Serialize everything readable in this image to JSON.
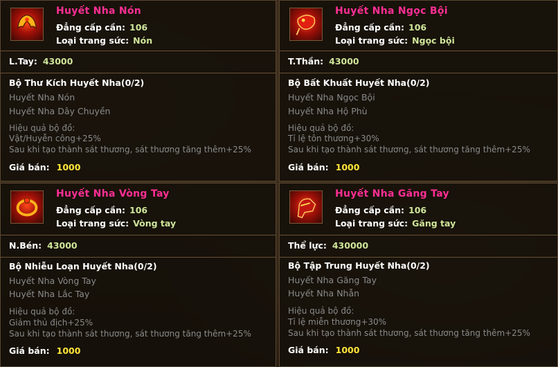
{
  "items": [
    {
      "name": "Huyết Nha Nón",
      "level_label": "Đẳng cấp cần:",
      "level": "106",
      "type_label": "Loại trang sức:",
      "type": "Nón",
      "stat_label": "L.Tay:",
      "stat_value": "43000",
      "set_title": "Bộ Thư Kích Huyết Nha(0/2)",
      "set_pieces": [
        "Huyết Nha Nón",
        "Huyết Nha Dây Chuyền"
      ],
      "effect_label": "Hiệu quả bộ đồ:",
      "effects": [
        "Vật/Huyễn công+25%",
        "Sau khi tạo thành sát thương, sát thương tăng thêm+25%"
      ],
      "price_label": "Giá bán:",
      "price": "1000",
      "icon": "helmet-icon"
    },
    {
      "name": "Huyết Nha Ngọc Bội",
      "level_label": "Đẳng cấp cần:",
      "level": "106",
      "type_label": "Loại trang sức:",
      "type": "Ngọc bội",
      "stat_label": "T.Thần:",
      "stat_value": "43000",
      "set_title": "Bộ Bất Khuất Huyết Nha(0/2)",
      "set_pieces": [
        "Huyết Nha Ngọc Bội",
        "Huyết Nha Hộ Phù"
      ],
      "effect_label": "Hiệu quả bộ đồ:",
      "effects": [
        "Tỉ lệ tôn thương+30%",
        "Sau khi tạo thành sát thương, sát thương tăng thêm+25%"
      ],
      "price_label": "Giá bán:",
      "price": "1000",
      "icon": "pendant-icon"
    },
    {
      "name": "Huyết Nha Vòng Tay",
      "level_label": "Đẳng cấp cần:",
      "level": "106",
      "type_label": "Loại trang sức:",
      "type": "Vòng tay",
      "stat_label": "N.Bén:",
      "stat_value": "43000",
      "set_title": "Bộ Nhiễu Loạn Huyết Nha(0/2)",
      "set_pieces": [
        "Huyết Nha Vòng Tay",
        "Huyết Nha Lắc Tay"
      ],
      "effect_label": "Hiệu quả bộ đồ:",
      "effects": [
        "Giảm thủ địch+25%",
        "Sau khi tạo thành sát thương, sát thương tăng thêm+25%"
      ],
      "price_label": "Giá bán:",
      "price": "1000",
      "icon": "bracelet-icon"
    },
    {
      "name": "Huyết Nha Găng Tay",
      "level_label": "Đẳng cấp cần:",
      "level": "106",
      "type_label": "Loại trang sức:",
      "type": "Găng tay",
      "stat_label": "Thể lực:",
      "stat_value": "430000",
      "set_title": "Bộ Tập Trung Huyết Nha(0/2)",
      "set_pieces": [
        "Huyết Nha Găng Tay",
        "Huyết Nha Nhẫn"
      ],
      "effect_label": "Hiệu quả bộ đồ:",
      "effects": [
        "Tỉ lệ miễn thương+30%",
        "Sau khi tạo thành sát thương, sát thương tăng thêm+25%"
      ],
      "price_label": "Giá bán:",
      "price": "1000",
      "icon": "gauntlet-icon"
    }
  ]
}
